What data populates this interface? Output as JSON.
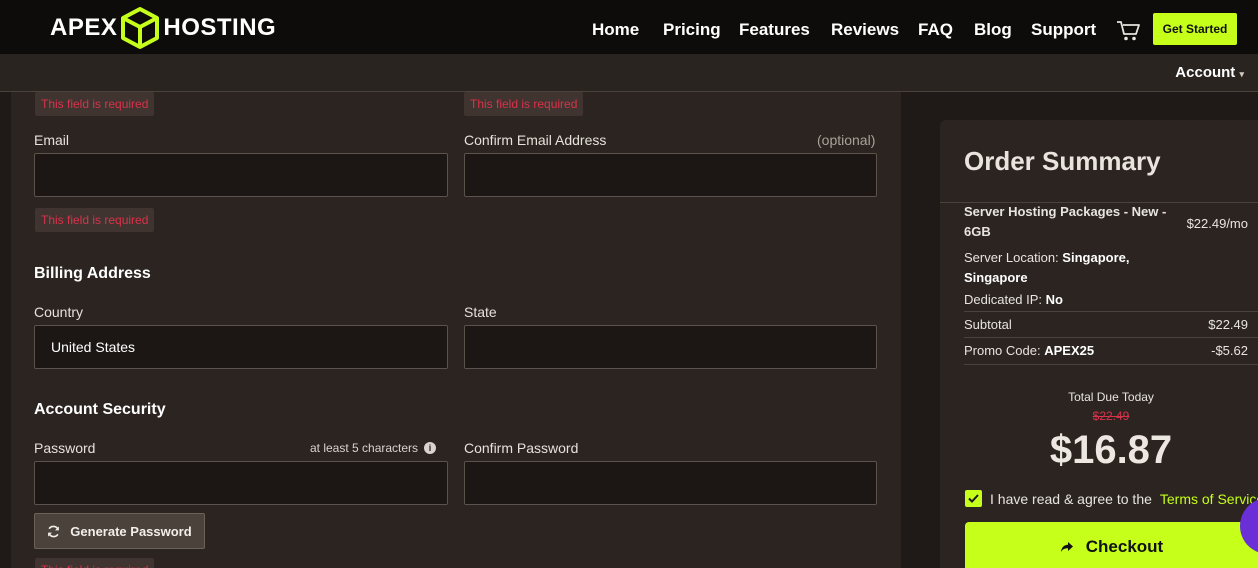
{
  "brand": {
    "left": "APEX",
    "right": "HOSTING"
  },
  "nav": {
    "items": [
      "Home",
      "Pricing",
      "Features",
      "Reviews",
      "FAQ",
      "Blog",
      "Support"
    ],
    "get_started": "Get Started",
    "account": "Account"
  },
  "form": {
    "error_text": "This field is required",
    "email_label": "Email",
    "confirm_email_label": "Confirm Email Address",
    "optional_text": "(optional)",
    "email_value": "",
    "confirm_email_value": "",
    "billing_heading": "Billing Address",
    "country_label": "Country",
    "country_value": "United States",
    "state_label": "State",
    "state_value": "",
    "security_heading": "Account Security",
    "password_label": "Password",
    "password_hint": "at least 5 characters",
    "confirm_password_label": "Confirm Password",
    "generate_password": "Generate Password"
  },
  "summary": {
    "title": "Order Summary",
    "product_line1": "Server Hosting Packages - New -",
    "product_line2": "6GB",
    "product_price": "$22.49/mo",
    "location_label": "Server Location:",
    "location_value1": "Singapore,",
    "location_value2": "Singapore",
    "ip_label": "Dedicated IP:",
    "ip_value": "No",
    "subtotal_label": "Subtotal",
    "subtotal_value": "$22.49",
    "promo_label": "Promo Code:",
    "promo_code": "APEX25",
    "promo_value": "-$5.62",
    "total_label": "Total Due Today",
    "original_total": "$22.49",
    "total": "$16.87",
    "agree_text": "I have read & agree to the",
    "tos_link": "Terms of Service",
    "checkout": "Checkout"
  },
  "colors": {
    "accent": "#c6ff1a",
    "error": "#d8324a",
    "bg": "#1f1a17"
  }
}
